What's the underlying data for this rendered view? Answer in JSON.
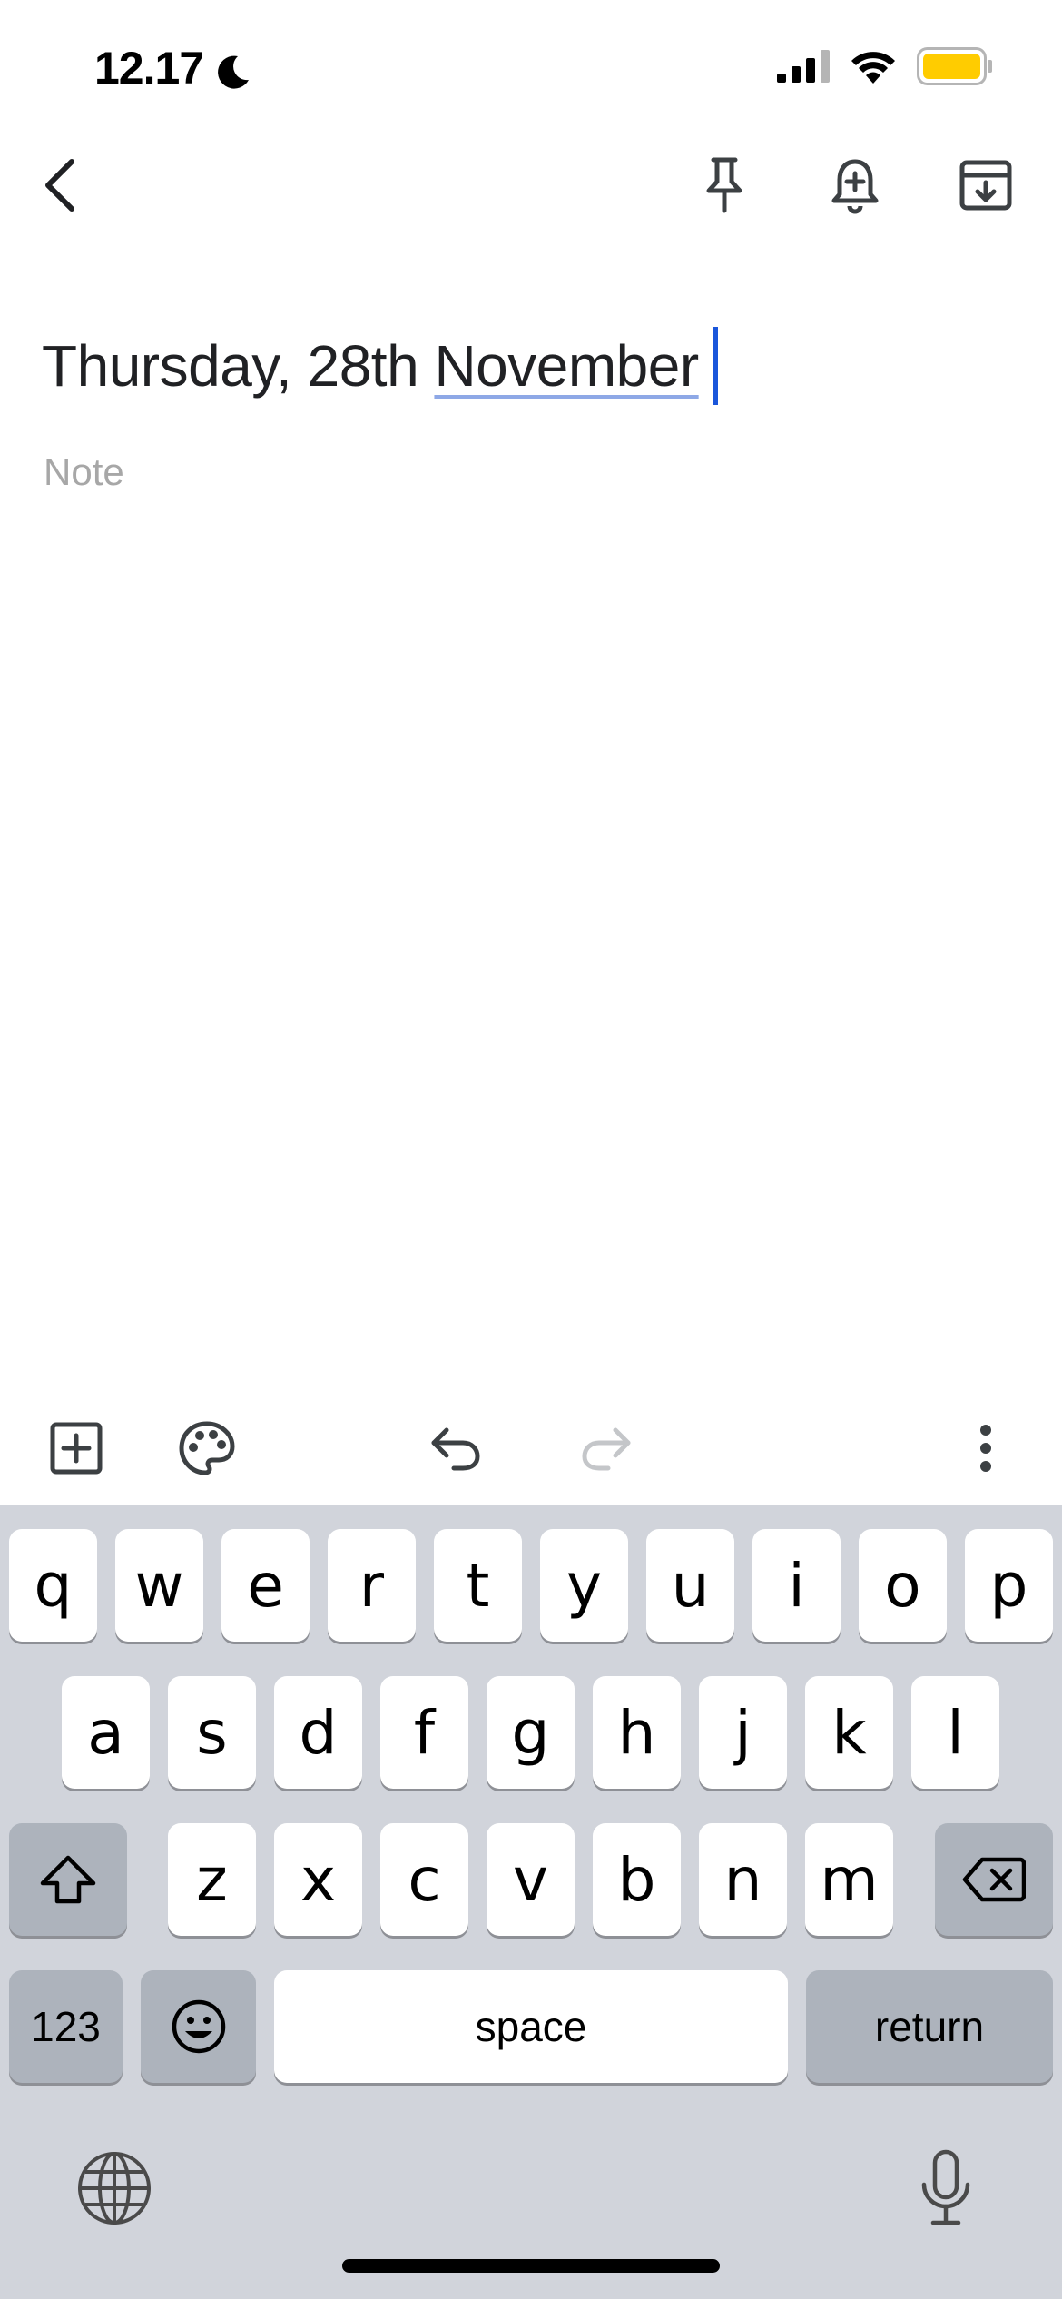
{
  "status_bar": {
    "time": "12.17",
    "icons": [
      "moon-icon",
      "cellular-signal-icon",
      "wifi-icon",
      "battery-icon"
    ],
    "battery_color": "#ffcc00"
  },
  "app_bar": {
    "icons": [
      "back-arrow-icon",
      "pin-icon",
      "reminder-bell-icon",
      "archive-icon"
    ]
  },
  "note": {
    "title_prefix": "Thursday, 28th ",
    "title_underlined": "November",
    "body_placeholder": "Note"
  },
  "editor_toolbar": {
    "icons": [
      "add-box-icon",
      "palette-icon",
      "undo-icon",
      "redo-icon",
      "more-vert-icon"
    ]
  },
  "keyboard": {
    "row1": [
      "q",
      "w",
      "e",
      "r",
      "t",
      "y",
      "u",
      "i",
      "o",
      "p"
    ],
    "row2": [
      "a",
      "s",
      "d",
      "f",
      "g",
      "h",
      "j",
      "k",
      "l"
    ],
    "row3": [
      "z",
      "x",
      "c",
      "v",
      "b",
      "n",
      "m"
    ],
    "numbers_label": "123",
    "space_label": "space",
    "return_label": "return",
    "icons": [
      "shift-icon",
      "backspace-icon",
      "emoji-icon",
      "globe-icon",
      "microphone-icon"
    ]
  },
  "colors": {
    "caret": "#1a56db",
    "keyboard_bg": "#d1d4db",
    "function_key": "#adb3bc"
  }
}
